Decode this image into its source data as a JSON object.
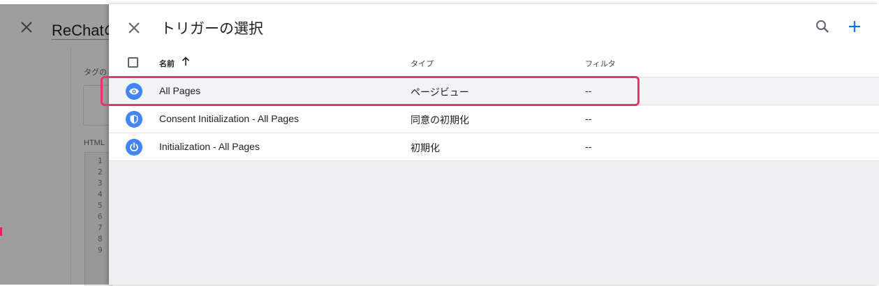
{
  "background_panel": {
    "title": "ReChatの",
    "tag_type_label": "タグの",
    "html_label": "HTML",
    "line_numbers": [
      "1",
      "2",
      "3",
      "4",
      "5",
      "6",
      "7",
      "8",
      "9"
    ]
  },
  "dialog": {
    "title": "トリガーの選択",
    "close_icon": "close-icon",
    "search_icon": "search-icon",
    "add_icon": "add-icon",
    "accent_color": "#1a73e8"
  },
  "table": {
    "columns": [
      "名前",
      "タイプ",
      "フィルタ"
    ],
    "sort": "ascending",
    "rows": [
      {
        "icon": "eye-icon",
        "name": "All Pages",
        "type": "ページビュー",
        "filter": "--",
        "selected": true
      },
      {
        "icon": "shield-icon",
        "name": "Consent Initialization - All Pages",
        "type": "同意の初期化",
        "filter": "--",
        "selected": false
      },
      {
        "icon": "power-icon",
        "name": "Initialization - All Pages",
        "type": "初期化",
        "filter": "--",
        "selected": false
      }
    ]
  },
  "colors": {
    "trigger_icon_bg": "#4285f4",
    "highlight_border": "#e8336d",
    "scrim": "rgba(0,0,0,0.38)"
  }
}
